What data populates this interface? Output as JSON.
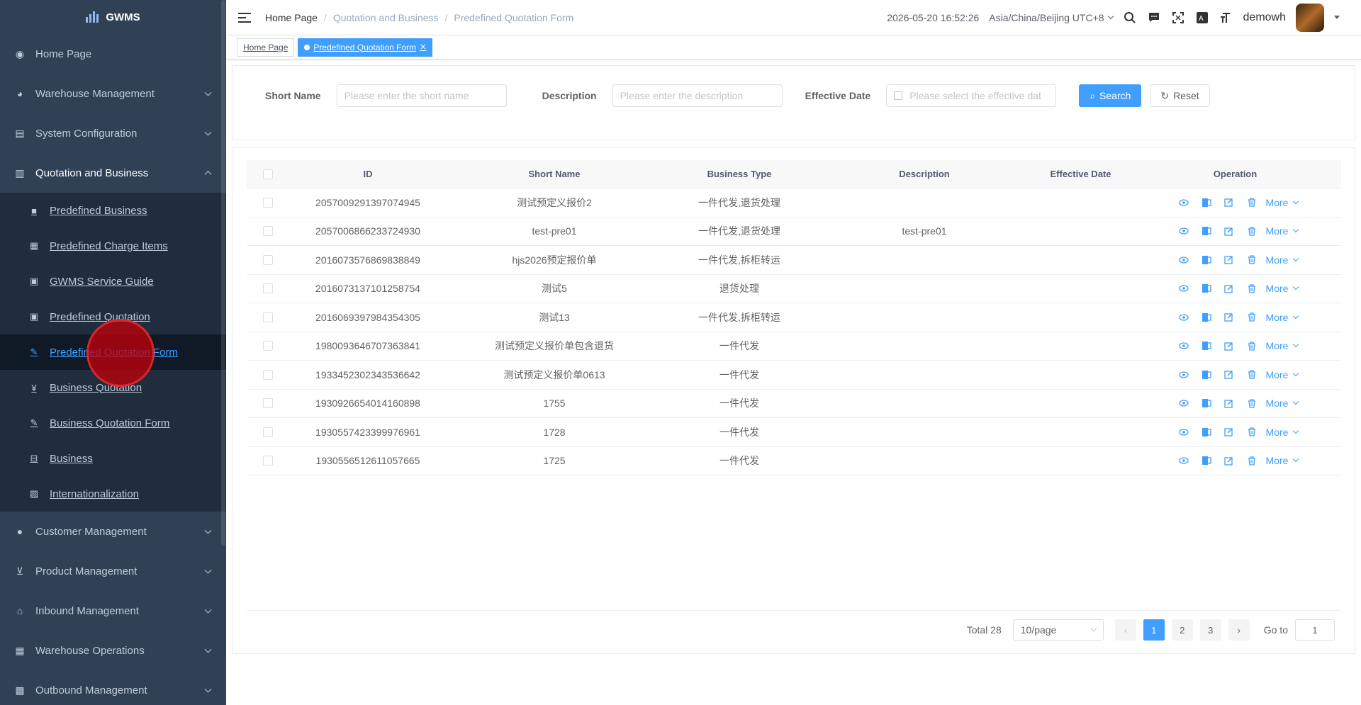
{
  "app": {
    "title": "GWMS"
  },
  "sidebar": {
    "items": [
      {
        "label": "Home Page",
        "icon": "dashboard-icon"
      },
      {
        "label": "Warehouse Management",
        "icon": "globe-icon"
      },
      {
        "label": "System Configuration",
        "icon": "config-icon"
      },
      {
        "label": "Quotation and Business",
        "icon": "document-icon"
      }
    ],
    "submenu": [
      {
        "label": "Predefined Business",
        "icon": "folder-icon"
      },
      {
        "label": "Predefined Charge Items",
        "icon": "table-icon"
      },
      {
        "label": "GWMS Service Guide",
        "icon": "guide-icon"
      },
      {
        "label": "Predefined Quotation",
        "icon": "quotation-icon"
      },
      {
        "label": "Predefined Quotation Form",
        "icon": "form-icon"
      },
      {
        "label": "Business Quotation",
        "icon": "yen-icon"
      },
      {
        "label": "Business Quotation Form",
        "icon": "form-icon"
      },
      {
        "label": "Business",
        "icon": "briefcase-icon"
      },
      {
        "label": "Internationalization",
        "icon": "language-icon"
      }
    ],
    "items_after": [
      {
        "label": "Customer Management",
        "icon": "user-icon"
      },
      {
        "label": "Product Management",
        "icon": "cart-icon"
      },
      {
        "label": "Inbound Management",
        "icon": "inbound-icon"
      },
      {
        "label": "Warehouse Operations",
        "icon": "grid-icon"
      },
      {
        "label": "Outbound Management",
        "icon": "apps-icon"
      }
    ]
  },
  "navbar": {
    "breadcrumb": [
      "Home Page",
      "Quotation and Business",
      "Predefined Quotation Form"
    ],
    "datetime": "2026-05-20 16:52:26",
    "timezone": "Asia/China/Beijing UTC+8",
    "username": "demowh"
  },
  "tags": {
    "home": "Home Page",
    "active": "Predefined Quotation Form"
  },
  "search": {
    "short_name_label": "Short Name",
    "short_name_placeholder": "Please enter the short name",
    "description_label": "Description",
    "description_placeholder": "Please enter the description",
    "effective_date_label": "Effective Date",
    "effective_date_placeholder": "Please select the effective dat",
    "search_button": "Search",
    "reset_button": "Reset"
  },
  "table": {
    "columns": [
      "ID",
      "Short Name",
      "Business Type",
      "Description",
      "Effective Date",
      "Operation"
    ],
    "more_label": "More",
    "rows": [
      {
        "id": "2057009291397074945",
        "short_name": "测试预定义报价2",
        "business_type": "一件代发,退货处理",
        "description": "",
        "effective_date": ""
      },
      {
        "id": "2057006866233724930",
        "short_name": "test-pre01",
        "business_type": "一件代发,退货处理",
        "description": "test-pre01",
        "effective_date": ""
      },
      {
        "id": "2016073576869838849",
        "short_name": "hjs2026预定报价单",
        "business_type": "一件代发,拆柜转运",
        "description": "",
        "effective_date": ""
      },
      {
        "id": "2016073137101258754",
        "short_name": "测试5",
        "business_type": "退货处理",
        "description": "",
        "effective_date": ""
      },
      {
        "id": "2016069397984354305",
        "short_name": "测试13",
        "business_type": "一件代发,拆柜转运",
        "description": "",
        "effective_date": ""
      },
      {
        "id": "1980093646707363841",
        "short_name": "测试预定义报价单包含退货",
        "business_type": "一件代发",
        "description": "",
        "effective_date": ""
      },
      {
        "id": "1933452302343536642",
        "short_name": "测试预定义报价单0613",
        "business_type": "一件代发",
        "description": "",
        "effective_date": ""
      },
      {
        "id": "1930926654014160898",
        "short_name": "1755",
        "business_type": "一件代发",
        "description": "",
        "effective_date": ""
      },
      {
        "id": "1930557423399976961",
        "short_name": "1728",
        "business_type": "一件代发",
        "description": "",
        "effective_date": ""
      },
      {
        "id": "1930556512611057665",
        "short_name": "1725",
        "business_type": "一件代发",
        "description": "",
        "effective_date": ""
      }
    ]
  },
  "pagination": {
    "total": "Total 28",
    "page_size": "10/page",
    "pages": [
      "1",
      "2",
      "3"
    ],
    "current": "1",
    "goto_label": "Go to",
    "goto_value": "1"
  },
  "colors": {
    "sidebar_bg": "#304156",
    "submenu_bg": "#1f2d3d",
    "accent": "#409eff"
  }
}
